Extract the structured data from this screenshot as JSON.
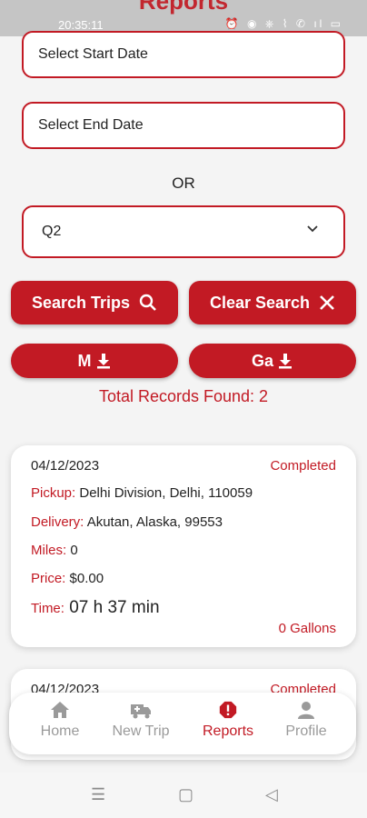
{
  "status_bar": {
    "time": "20:35:11",
    "icons": "⏰ ◉ ⎈ ⌇ ✆ ıl ▭"
  },
  "page_title": "Reports",
  "filters": {
    "start_date_placeholder": "Select Start Date",
    "end_date_placeholder": "Select End Date",
    "or_label": "OR",
    "quarter_selected": "Q2"
  },
  "buttons": {
    "search": "Search Trips",
    "clear": "Clear Search",
    "export_m": "M",
    "export_ga": "Ga"
  },
  "total_records": "Total Records Found: 2",
  "trips": [
    {
      "date": "04/12/2023",
      "status": "Completed",
      "pickup_label": "Pickup:",
      "pickup": "Delhi Division, Delhi, 110059",
      "delivery_label": "Delivery:",
      "delivery": "Akutan, Alaska, 99553",
      "miles_label": "Miles:",
      "miles": "0",
      "price_label": "Price:",
      "price": "$0.00",
      "time_label": "Time:",
      "time": "07 h 37 min",
      "gallons": "0 Gallons"
    },
    {
      "date": "04/12/2023",
      "status": "Completed"
    }
  ],
  "nav": {
    "home": "Home",
    "new_trip": "New Trip",
    "reports": "Reports",
    "profile": "Profile"
  },
  "colors": {
    "accent": "#c21a24",
    "inactive": "#9a9a9a"
  }
}
